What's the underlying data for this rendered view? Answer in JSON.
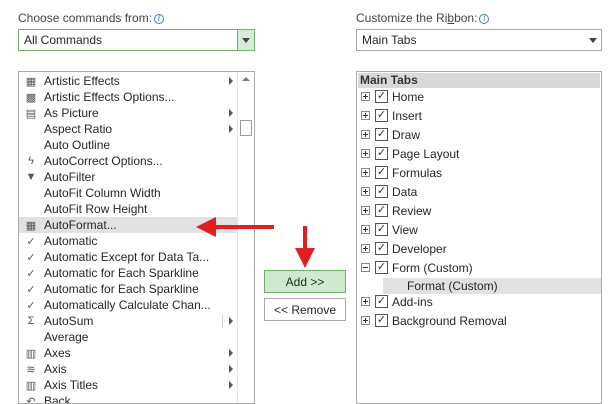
{
  "left": {
    "caption_pre": "Choose commands from:",
    "dropdown_value": "All Commands",
    "items": [
      {
        "label": "Artistic Effects",
        "icon": "artistic-effects-icon",
        "glyph": "▦",
        "sub": true
      },
      {
        "label": "Artistic Effects Options...",
        "icon": "artistic-options-icon",
        "glyph": "▩",
        "sub": false
      },
      {
        "label": "As Picture",
        "icon": "as-picture-icon",
        "glyph": "▤",
        "sub": true
      },
      {
        "label": "Aspect Ratio",
        "icon": "",
        "glyph": "",
        "sub": true
      },
      {
        "label": "Auto Outline",
        "icon": "",
        "glyph": "",
        "sub": false
      },
      {
        "label": "AutoCorrect Options...",
        "icon": "lightning-icon",
        "glyph": "ϟ",
        "sub": false
      },
      {
        "label": "AutoFilter",
        "icon": "filter-icon",
        "glyph": "▼",
        "sub": false
      },
      {
        "label": "AutoFit Column Width",
        "icon": "",
        "glyph": "",
        "sub": false
      },
      {
        "label": "AutoFit Row Height",
        "icon": "",
        "glyph": "",
        "sub": false
      },
      {
        "label": "AutoFormat...",
        "icon": "table-format-icon",
        "glyph": "▦",
        "sub": false,
        "selected": true
      },
      {
        "label": "Automatic",
        "icon": "check-icon",
        "glyph": "✓",
        "sub": false
      },
      {
        "label": "Automatic Except for Data Ta...",
        "icon": "check-icon",
        "glyph": "✓",
        "sub": false
      },
      {
        "label": "Automatic for Each Sparkline",
        "icon": "check-icon",
        "glyph": "✓",
        "sub": false
      },
      {
        "label": "Automatic for Each Sparkline",
        "icon": "check-icon",
        "glyph": "✓",
        "sub": false
      },
      {
        "label": "Automatically Calculate Chan...",
        "icon": "check-icon",
        "glyph": "✓",
        "sub": false
      },
      {
        "label": "AutoSum",
        "icon": "sigma-icon",
        "glyph": "Σ",
        "sub": true,
        "split": true
      },
      {
        "label": "Average",
        "icon": "",
        "glyph": "",
        "sub": false
      },
      {
        "label": "Axes",
        "icon": "axes-icon",
        "glyph": "▥",
        "sub": true
      },
      {
        "label": "Axis",
        "icon": "axis-icon",
        "glyph": "≋",
        "sub": true
      },
      {
        "label": "Axis Titles",
        "icon": "axis-titles-icon",
        "glyph": "▥",
        "sub": true
      },
      {
        "label": "Back",
        "icon": "back-icon",
        "glyph": "↶",
        "sub": false
      }
    ]
  },
  "middle": {
    "add_label": "Add >>",
    "remove_label": "<< Remove"
  },
  "right": {
    "caption_pre": "Customize the Ri",
    "caption_ul": "b",
    "caption_post": "bon:",
    "dropdown_value": "Main Tabs",
    "tree_header": "Main Tabs",
    "tabs": [
      {
        "label": "Home",
        "checked": true,
        "expanded": false
      },
      {
        "label": "Insert",
        "checked": true,
        "expanded": false
      },
      {
        "label": "Draw",
        "checked": true,
        "expanded": false
      },
      {
        "label": "Page Layout",
        "checked": true,
        "expanded": false
      },
      {
        "label": "Formulas",
        "checked": true,
        "expanded": false
      },
      {
        "label": "Data",
        "checked": true,
        "expanded": false
      },
      {
        "label": "Review",
        "checked": true,
        "expanded": false
      },
      {
        "label": "View",
        "checked": true,
        "expanded": false
      },
      {
        "label": "Developer",
        "checked": true,
        "expanded": false
      },
      {
        "label": "Form (Custom)",
        "checked": true,
        "expanded": true
      },
      {
        "label": "Add-ins",
        "checked": true,
        "expanded": false
      },
      {
        "label": "Background Removal",
        "checked": true,
        "expanded": false
      }
    ],
    "child_label": "Format (Custom)"
  },
  "colors": {
    "accent_green": "#6bb36b",
    "annotation_red": "#e02020"
  }
}
